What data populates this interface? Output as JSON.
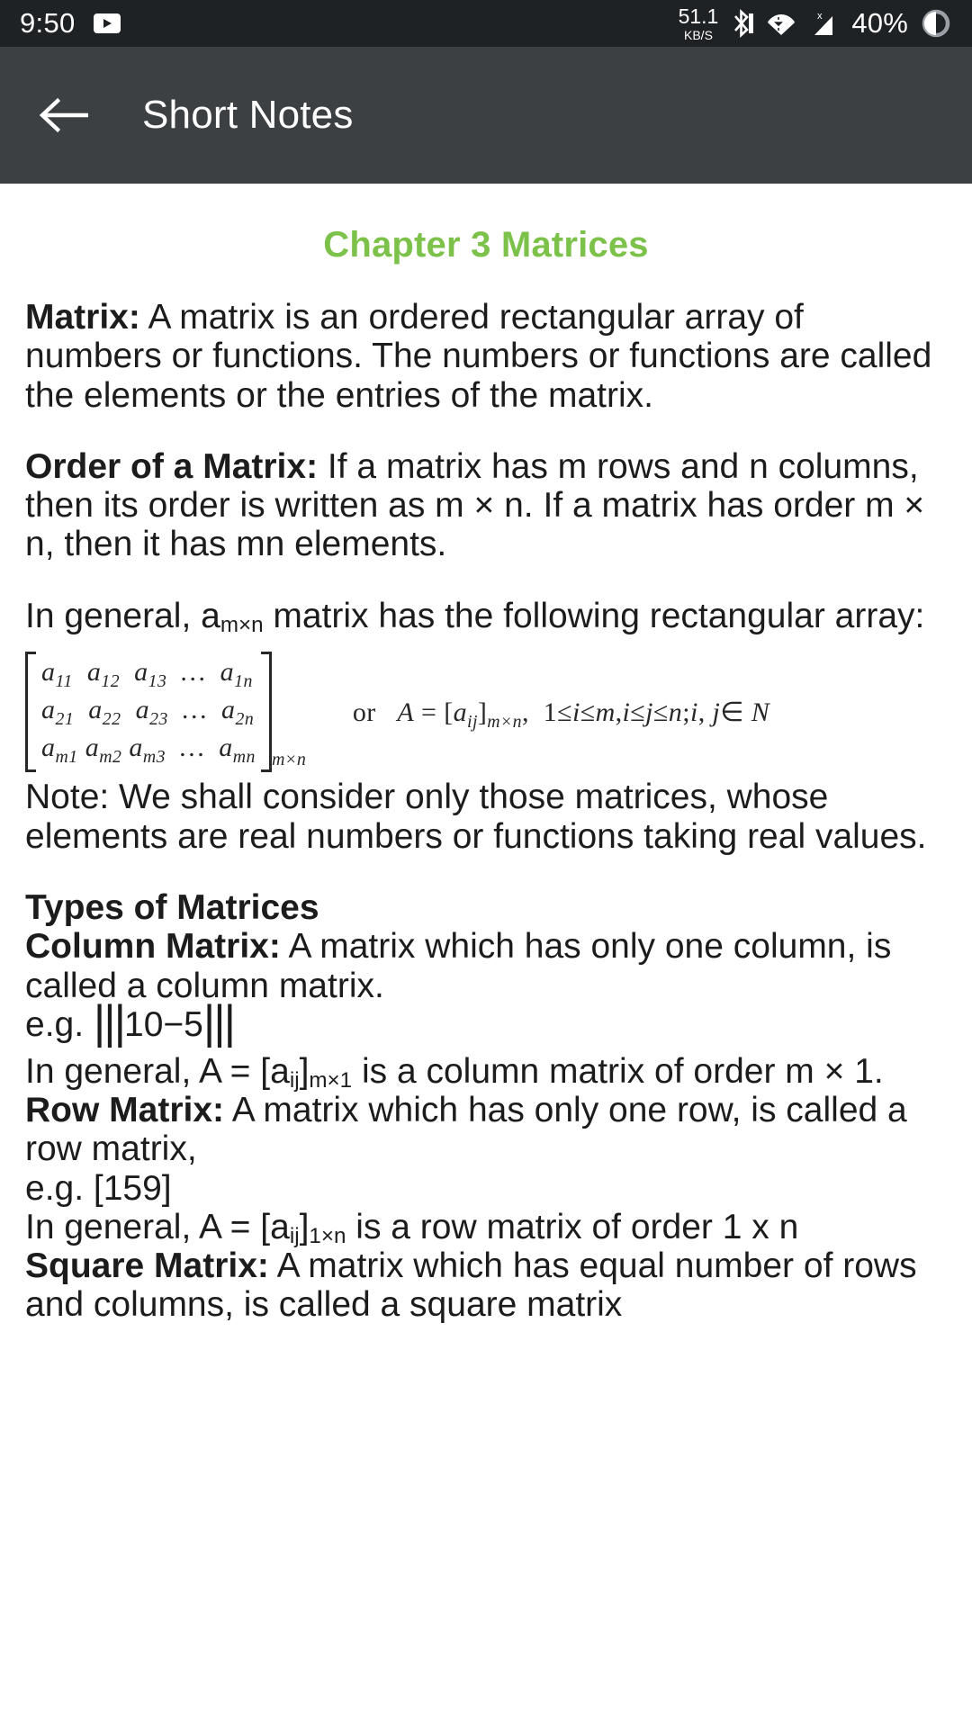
{
  "status_bar": {
    "clock": "9:50",
    "app_icon": "youtube-play-icon",
    "net_speed_value": "51.1",
    "net_speed_unit": "KB/S",
    "icons": [
      "bluetooth-icon",
      "wifi-icon",
      "mobile-signal-icon"
    ],
    "battery_percent": "40%",
    "battery_icon": "battery-circle-icon",
    "background": "#1f2225"
  },
  "app_bar": {
    "back_icon": "back-arrow-icon",
    "title": "Short Notes",
    "background": "#3c4043"
  },
  "content": {
    "chapter_title": "Chapter 3 Matrices",
    "chapter_title_color": "#7cc24a",
    "paragraphs": [
      {
        "id": "matrix-definition",
        "lead": "Matrix:",
        "body": " A matrix is an ordered rectangular array of numbers or functions. The numbers or functions are called the elements or the entries of the matrix."
      },
      {
        "id": "order-of-matrix",
        "lead": "Order of a Matrix:",
        "body": " If a matrix has m rows and n columns, then its order is written as m × n. If a matrix has order m × n, then it has mn elements."
      }
    ],
    "in_general_line": {
      "before": "In general, a",
      "sub": "m×n",
      "after": " matrix has the following rectangular array:"
    },
    "matrix_figure": {
      "rows": [
        [
          {
            "b": "a",
            "s": "11"
          },
          {
            "b": "a",
            "s": "12"
          },
          {
            "b": "a",
            "s": "13"
          },
          {
            "b": "…",
            "s": ""
          },
          {
            "b": "a",
            "s": "1n"
          }
        ],
        [
          {
            "b": "a",
            "s": "21"
          },
          {
            "b": "a",
            "s": "22"
          },
          {
            "b": "a",
            "s": "23"
          },
          {
            "b": "…",
            "s": ""
          },
          {
            "b": "a",
            "s": "2n"
          }
        ],
        [
          {
            "b": "a",
            "s": "m1"
          },
          {
            "b": "a",
            "s": "m2"
          },
          {
            "b": "a",
            "s": "m3"
          },
          {
            "b": "…",
            "s": ""
          },
          {
            "b": "a",
            "s": "mn"
          }
        ]
      ],
      "order_subscript": "m×n",
      "or_label": "or",
      "rhs": "A = [aⁱⱼ]ₘₓₙ, 1≤i≤m, i≤j≤n; i, j ∈ N",
      "rhs_plain": "A = [aij]m×n, 1≤i≤m,i≤j≤n;i, j ∈ N"
    },
    "note_paragraph": "Note: We shall consider only those matrices, whose elements are real numbers or functions taking real values.",
    "types_heading": "Types of Matrices",
    "column_matrix": {
      "lead": "Column Matrix:",
      "body": " A matrix which has only one column, is called a column matrix.",
      "example_prefix": "e.g. ",
      "example_bars_left": "|||",
      "example_value": "10−5",
      "example_bars_right": "|||",
      "general_before": "In general, A = [a",
      "general_sub_ij": "ij",
      "general_mid": "]",
      "general_sub_order": "m×1",
      "general_after": " is a column matrix of order m × 1."
    },
    "row_matrix": {
      "lead": "Row Matrix:",
      "body": " A matrix which has only one row, is called a row matrix,",
      "example": "e.g. [159]",
      "general_before": "In general, A = [a",
      "general_sub_ij": "ij",
      "general_mid": "]",
      "general_sub_order": "1×n",
      "general_after": " is a row matrix of order 1 x n"
    },
    "square_matrix": {
      "lead": "Square Matrix:",
      "body": " A matrix which has equal number of rows and columns, is called a square matrix"
    }
  }
}
